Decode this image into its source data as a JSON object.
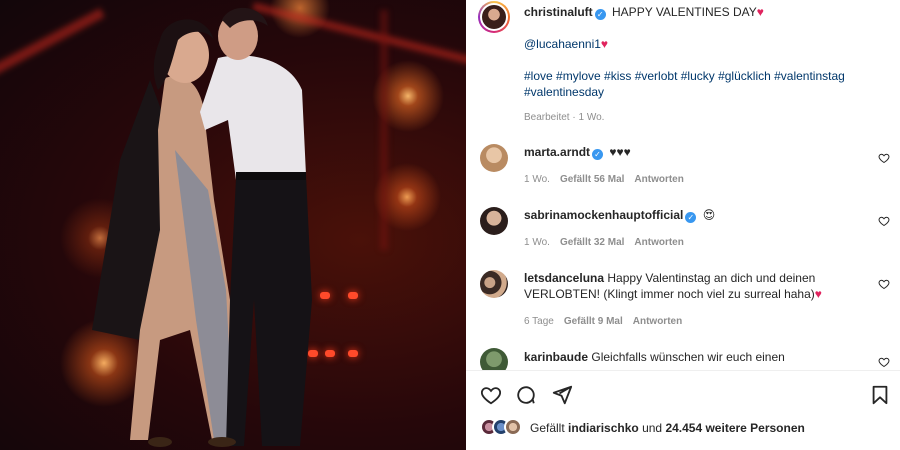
{
  "post": {
    "author": "christinaluft",
    "caption_text": "HAPPY VALENTINES DAY",
    "mention": "@lucahaenni1",
    "hashtags": "#love #mylove #kiss #verlobt #lucky #glücklich #valentinstag #valentinesday",
    "meta": "Bearbeitet · 1 Wo."
  },
  "comments": [
    {
      "user": "marta.arndt",
      "verified": true,
      "text": "♥♥♥",
      "age": "1 Wo.",
      "likes": "Gefällt 56 Mal",
      "reply": "Antworten"
    },
    {
      "user": "sabrinamockenhauptofficial",
      "verified": true,
      "text": "😍",
      "age": "1 Wo.",
      "likes": "Gefällt 32 Mal",
      "reply": "Antworten"
    },
    {
      "user": "letsdanceluna",
      "verified": false,
      "text": "Happy Valentinstag an dich und deinen VERLOBTEN! (Klingt immer noch viel zu surreal haha)",
      "age": "6 Tage",
      "likes": "Gefällt 9 Mal",
      "reply": "Antworten"
    },
    {
      "user": "karinbaude",
      "verified": false,
      "text": "Gleichfalls wünschen wir euch einen"
    }
  ],
  "likes_bar": {
    "prefix": "Gefällt",
    "first_liker": "indiarischko",
    "middle": "und",
    "count": "24.454 weitere Personen"
  },
  "icons": {
    "like": "heart-outline-icon",
    "comment": "comment-bubble-icon",
    "share": "paper-plane-icon",
    "save": "bookmark-icon",
    "verified": "verified-badge-icon"
  },
  "colors": {
    "verified": "#3897f0",
    "link": "#00376b",
    "muted": "#8e8e8e",
    "heart": "#e0245e"
  }
}
